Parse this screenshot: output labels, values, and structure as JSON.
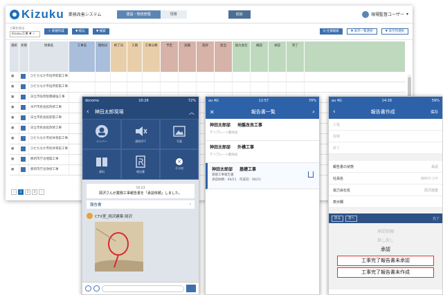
{
  "colors": {
    "brand": "#1d70b8",
    "desktop_tab_active": "#5b86b3",
    "chat_header": "#27497a",
    "mobile_header": "#2e62a8",
    "highlight_border": "#e0302c",
    "grid_col_blue": "#a9bedb",
    "grid_col_orange": "#e8cfa9",
    "grid_col_brown": "#d6b2a8",
    "grid_col_green": "#bfd9be"
  },
  "desktop": {
    "brand": "Kizuku",
    "brand_sub": "業務改善システム",
    "tabs": [
      "建設・物流管理",
      "現場"
    ],
    "top_button": "追加",
    "user_name": "現場監督ユーザー",
    "filters": {
      "filter1_label": "工事名/担当",
      "filter1_value": "Kizuku工事 ▼ ✓",
      "button1": "＋ 新規作成",
      "button2": "▼ 絞込",
      "button3": "▼ 検索",
      "right_button": "Q 仕様検索",
      "right_label": "表示切替",
      "ghost1": "▼ 表示一覧選択",
      "ghost2": "▼ 表示列選択"
    },
    "grid_headers": [
      "選択",
      "状態",
      "現場名",
      "工事名",
      "開始日",
      "終了日",
      "工期",
      "工事分類",
      "予定",
      "実績",
      "進捗",
      "担当",
      "協力会社",
      "確認",
      "承認",
      "完了"
    ],
    "row_names": [
      "ひたちなか市役所新築工事",
      "ひたちなか市役所新築工事",
      "日立市役所耐震補強工事",
      "水戸市民会館改修工事",
      "日立市民会館新築工事",
      "日立市民会館改修工事",
      "ひたちなか市民体育館工事",
      "ひたちなか市民体育館工事",
      "那珂市庁舎増築工事",
      "那珂市庁舎改修工事"
    ],
    "pager": [
      "‹",
      "1",
      "2",
      "3",
      "›"
    ]
  },
  "phone1": {
    "status_left": "docomo",
    "status_time": "10:26",
    "status_right": "72%",
    "header_title": "神田太郎現場",
    "grid_items": [
      "メンバー",
      "通知OFF",
      "写真",
      "資料",
      "報告書",
      "その他"
    ],
    "notice_time": "10:23",
    "notice_msg": "岡沢さんが業務工事報告書を「承認依頼」しました。",
    "report_label": "報告書",
    "sender": "CTX室_岡沢建築 岡沢"
  },
  "phone2": {
    "status_left": "au 4G",
    "status_time": "12:57",
    "status_right": "70%",
    "header_title": "報告書一覧",
    "items": [
      {
        "site": "神田太郎邸",
        "work": "地盤改良工事",
        "sub": "テンプレート無効化"
      },
      {
        "site": "神田太郎邸",
        "work": "外構工事",
        "sub": "テンプレート無効化"
      },
      {
        "site": "神田太郎邸",
        "work": "基礎工事",
        "sub": "基礎工事報告書",
        "meta": "承認依頼：08/21　作成日：08/21"
      }
    ]
  },
  "phone3": {
    "status_left": "au 4G",
    "status_time": "14:16",
    "status_right": "59%",
    "header_title": "報告書作成",
    "header_right": "保存",
    "faded_rows": [
      "工程",
      "現場",
      "終了"
    ],
    "rows": [
      {
        "label": "報告書の状態",
        "value": "承認"
      },
      {
        "label": "社員名",
        "value": "田中たつや"
      },
      {
        "label": "協力会社名",
        "value": "岡沢建築"
      },
      {
        "label": "表示欄",
        "value": ""
      }
    ],
    "picker_buttons": [
      "戻る",
      "次へ"
    ],
    "picker_done": "完了",
    "options": [
      "承認依頼",
      "差し戻し",
      "承認"
    ],
    "highlighted": [
      "工事完了報告書未承認",
      "工事完了報告書未作成"
    ]
  }
}
